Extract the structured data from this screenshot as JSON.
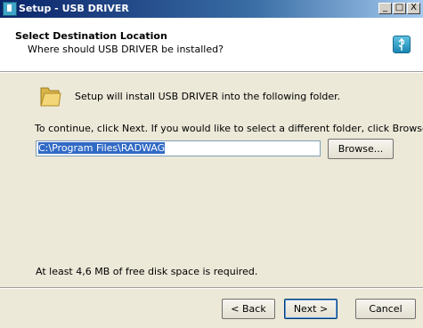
{
  "window": {
    "title": "Setup - USB DRIVER",
    "controls": [
      "_",
      "□",
      "X"
    ]
  },
  "header": {
    "title": "Select Destination Location",
    "subtitle": "Where should USB DRIVER be installed?"
  },
  "body": {
    "install_note": "Setup will install USB DRIVER into the following folder.",
    "instruction": "To continue, click Next. If you would like to select a different folder, click Browse.",
    "path_value": "C:\\Program Files\\RADWAG",
    "browse_label": "Browse...",
    "space_note": "At least 4,6 MB of free disk space is required."
  },
  "footer": {
    "back_label": "< Back",
    "next_label": "Next >",
    "cancel_label": "Cancel"
  }
}
